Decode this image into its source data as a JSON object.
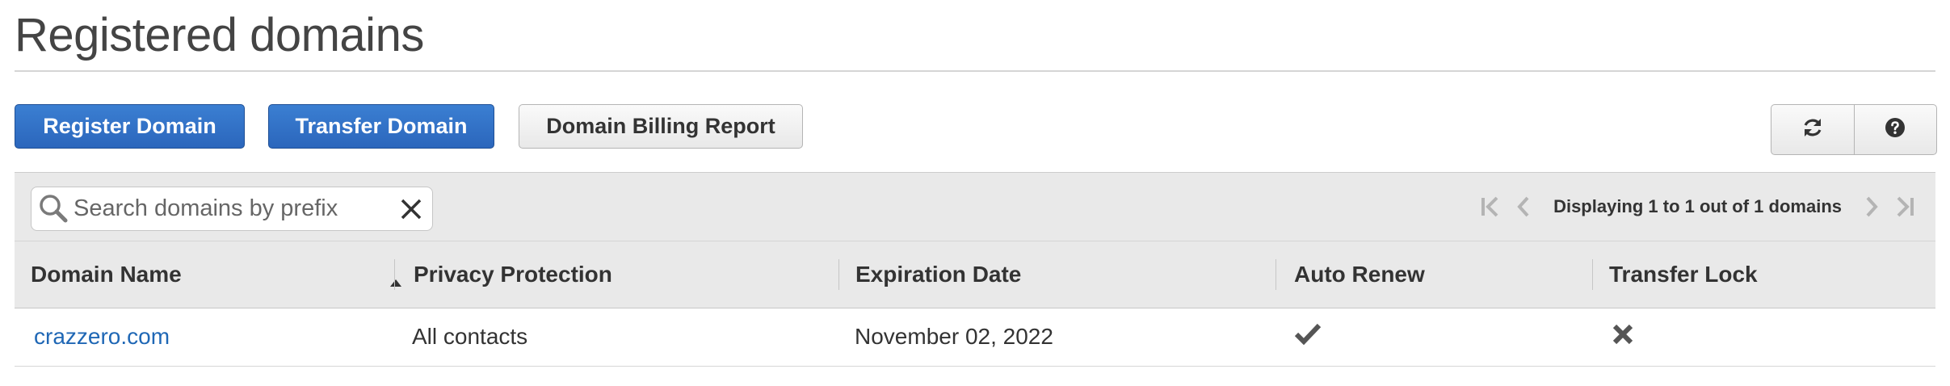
{
  "page": {
    "title": "Registered domains"
  },
  "toolbar": {
    "register_label": "Register Domain",
    "transfer_label": "Transfer Domain",
    "billing_label": "Domain Billing Report",
    "refresh_icon": "refresh-icon",
    "help_icon": "help-icon"
  },
  "search": {
    "placeholder": "Search domains by prefix",
    "value": ""
  },
  "pagination": {
    "text": "Displaying 1 to 1 out of 1 domains"
  },
  "table": {
    "columns": [
      "Domain Name",
      "Privacy Protection",
      "Expiration Date",
      "Auto Renew",
      "Transfer Lock"
    ],
    "sort": {
      "column": "Domain Name",
      "direction": "ascending"
    },
    "rows": [
      {
        "domain_name": "crazzero.com",
        "privacy_protection": "All contacts",
        "expiration_date": "November 02, 2022",
        "auto_renew": true,
        "transfer_lock": false
      }
    ]
  },
  "colors": {
    "primary_button": "#2b66bc",
    "link": "#1f67b5",
    "band": "#e9e9e9"
  }
}
